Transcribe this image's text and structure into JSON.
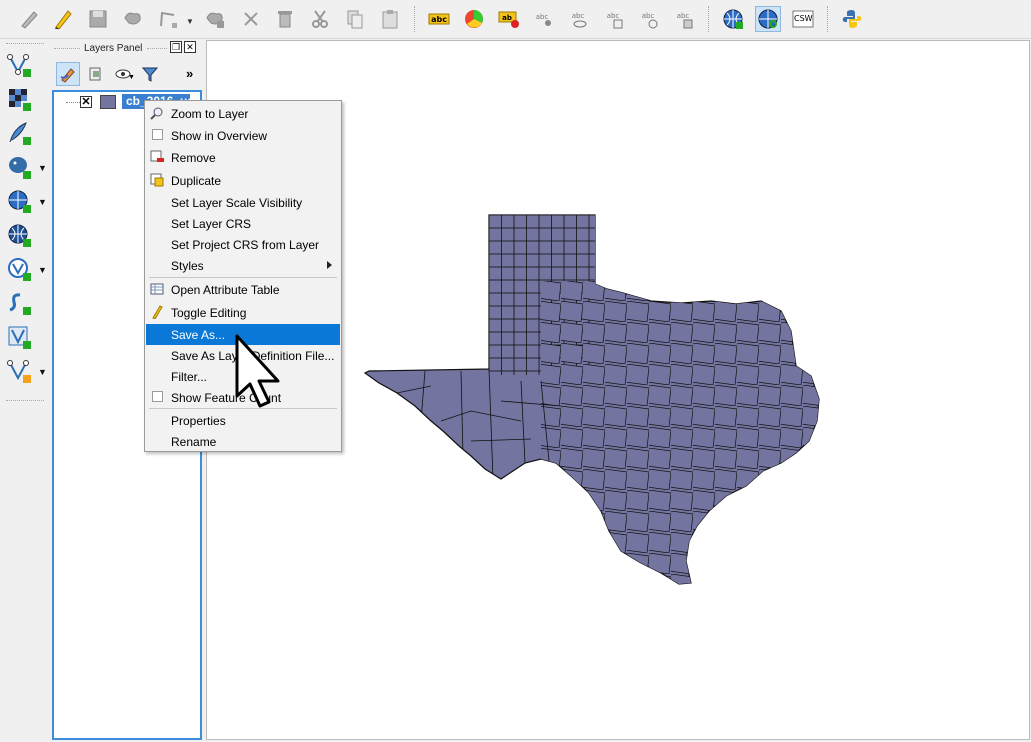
{
  "toolbar": {
    "csw_label": "CSW",
    "label_icon_text": "abc"
  },
  "layers_panel": {
    "title": "Layers Panel",
    "more": "»",
    "layer_name": "cb_2016_us"
  },
  "context_menu": {
    "items": [
      {
        "label": "Zoom to Layer"
      },
      {
        "label": "Show in Overview"
      },
      {
        "label": "Remove"
      },
      {
        "label": "Duplicate"
      },
      {
        "label": "Set Layer Scale Visibility"
      },
      {
        "label": "Set Layer CRS"
      },
      {
        "label": "Set Project CRS from Layer"
      },
      {
        "label": "Styles"
      },
      {
        "label": "Open Attribute Table"
      },
      {
        "label": "Toggle Editing"
      },
      {
        "label": "Save As..."
      },
      {
        "label": "Save As Layer Definition File..."
      },
      {
        "label": "Filter..."
      },
      {
        "label": "Show Feature Count"
      },
      {
        "label": "Properties"
      },
      {
        "label": "Rename"
      }
    ],
    "highlighted": "Save As..."
  },
  "colors": {
    "accent": "#0a78d7",
    "polygon_fill": "#7474a0",
    "polygon_stroke": "#111111"
  }
}
